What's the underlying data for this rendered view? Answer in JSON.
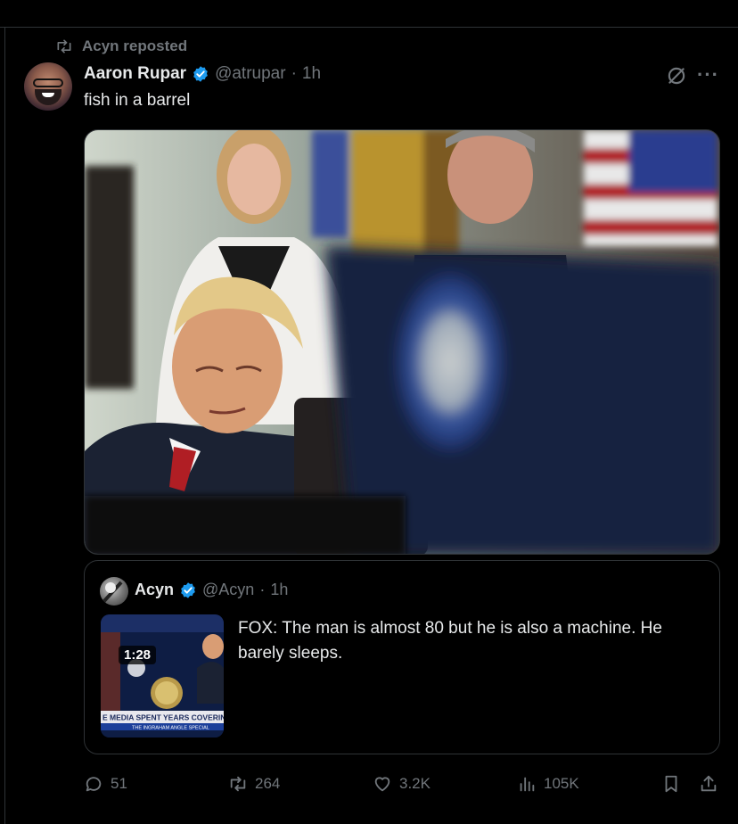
{
  "repost": {
    "label": "Acyn reposted"
  },
  "tweet": {
    "author_name": "Aaron Rupar",
    "handle": "@atrupar",
    "time": "1h",
    "text": "fish in a barrel"
  },
  "quote": {
    "author_name": "Acyn",
    "handle": "@Acyn",
    "time": "1h",
    "text": "FOX: The man is almost 80 but he is also a machine. He barely sleeps.",
    "video_duration": "1:28",
    "thumb_caption": "E MEDIA SPENT YEARS COVERING FO",
    "thumb_subcaption": "THE INGRAHAM ANGLE SPECIAL"
  },
  "actions": {
    "replies": "51",
    "reposts": "264",
    "likes": "3.2K",
    "views": "105K"
  },
  "colors": {
    "verified": "#1d9bf0",
    "muted": "#71767b",
    "text": "#e7e9ea",
    "border": "#2f3336"
  }
}
